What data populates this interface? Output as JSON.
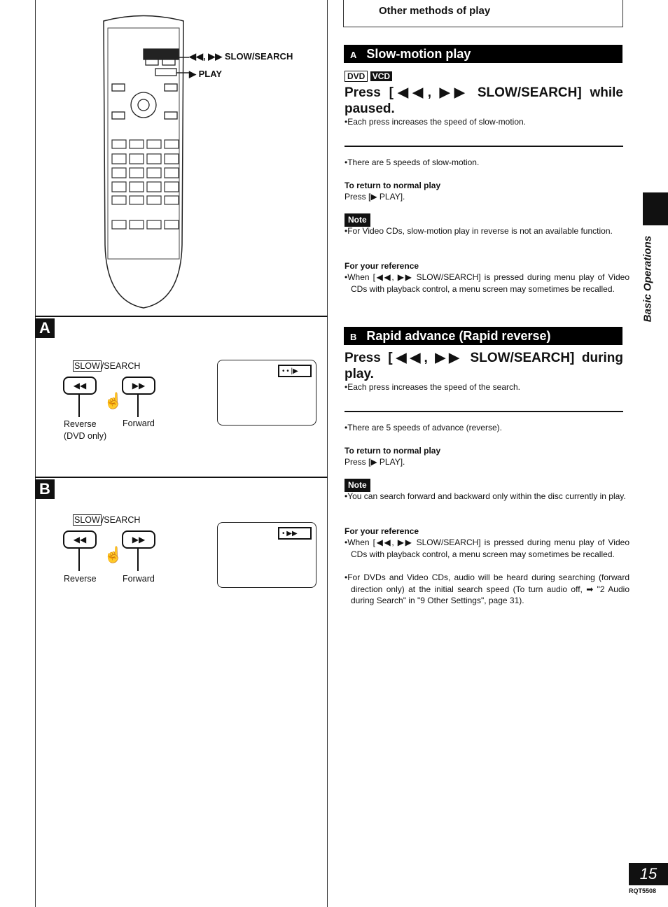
{
  "header": {
    "title": "Other methods of play"
  },
  "left": {
    "remote_labels": {
      "search": "◀◀, ▶▶ SLOW/SEARCH",
      "play": "▶ PLAY"
    },
    "section_a": {
      "letter": "A",
      "button_label_slow": "SLOW",
      "button_label_search": "/SEARCH",
      "rev_glyph": "◀◀",
      "fwd_glyph": "▶▶",
      "reverse": "Reverse",
      "reverse_note": "(DVD only)",
      "forward": "Forward",
      "osd": "• • |▶"
    },
    "section_b": {
      "letter": "B",
      "button_label_slow": "SLOW",
      "button_label_search": "/SEARCH",
      "rev_glyph": "◀◀",
      "fwd_glyph": "▶▶",
      "reverse": "Reverse",
      "forward": "Forward",
      "osd": "• ▶▶"
    }
  },
  "slow_motion": {
    "letter": "A",
    "title": "Slow-motion play",
    "badges": [
      "DVD",
      "VCD"
    ],
    "heading": "Press [◀◀, ▶▶ SLOW/SEARCH] while paused.",
    "bullet1": "•Each press increases the speed of slow-motion.",
    "bullet2": "•There are 5 speeds of slow-motion.",
    "return_title": "To return to normal play",
    "return_text": "Press [▶ PLAY].",
    "note_label": "Note",
    "note_text": "•For Video CDs, slow-motion play in reverse is not an available function.",
    "ref_title": "For your reference",
    "ref_text": "•When [◀◀, ▶▶ SLOW/SEARCH] is pressed during menu play of Video CDs with playback control, a menu screen may sometimes be recalled."
  },
  "rapid": {
    "letter": "B",
    "title": "Rapid advance (Rapid reverse)",
    "heading": "Press [◀◀, ▶▶ SLOW/SEARCH] during play.",
    "bullet1": "•Each press increases the speed of the search.",
    "bullet2": "•There are 5 speeds of advance (reverse).",
    "return_title": "To return to normal play",
    "return_text": "Press [▶ PLAY].",
    "note_label": "Note",
    "note_text": "•You can search forward and backward only within the disc currently in play.",
    "ref_title": "For your reference",
    "ref_text1": "•When [◀◀, ▶▶ SLOW/SEARCH] is pressed during menu play of Video CDs with playback control, a menu screen may sometimes be recalled.",
    "ref_text2": "•For DVDs and Video CDs, audio will be heard during searching (forward direction only) at the initial search speed (To turn audio off, ➡ \"2 Audio during Search\" in \"9 Other Settings\", page 31)."
  },
  "side_tab": {
    "label": "Basic Operations"
  },
  "footer": {
    "page_number": "15",
    "doc_code": "RQT5508"
  }
}
